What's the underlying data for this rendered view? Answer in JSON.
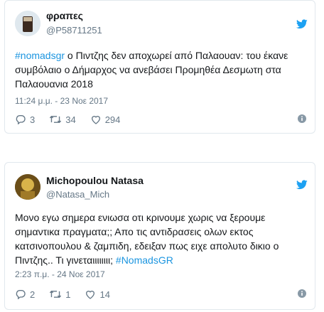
{
  "tweets": [
    {
      "name": "φραπες",
      "handle": "@P58711251",
      "hashtag": "#nomadsgr",
      "text": " ο Πιντζης δεν αποχωρεί από Παλαουαν: του έκανε συμβόλαιο ο Δήμαρχος να ανεβάσει Προμηθέα Δεσμωτη στα Παλαουανια 2018",
      "time": "11:24 μ.μ. - 23 Νοε 2017",
      "replies": "3",
      "retweets": "34",
      "likes": "294"
    },
    {
      "name": "Michopoulou Natasa",
      "handle": "@Natasa_Mich",
      "text": "Μονο εγω σημερα ενιωσα οτι κρινουμε χωρις να ξερουμε σημαντικα πραγματα;; Απο τις αντιδρασεις ολων εκτος κατσινοπουλου & ζαμπιδη, εδειξαν πως ειχε απολυτο δικιο ο Πιντζης.. Τι γινεταιιιιιιιι; ",
      "hashtag": "#NomadsGR",
      "time": "2:23 π.μ. - 24 Νοε 2017",
      "replies": "2",
      "retweets": "1",
      "likes": "14"
    }
  ],
  "colors": {
    "accent": "#1b95e0",
    "muted": "#657786",
    "border": "#e1e8ed"
  },
  "icons": [
    "twitter-bird-icon",
    "reply-icon",
    "retweet-icon",
    "like-icon",
    "info-icon"
  ]
}
